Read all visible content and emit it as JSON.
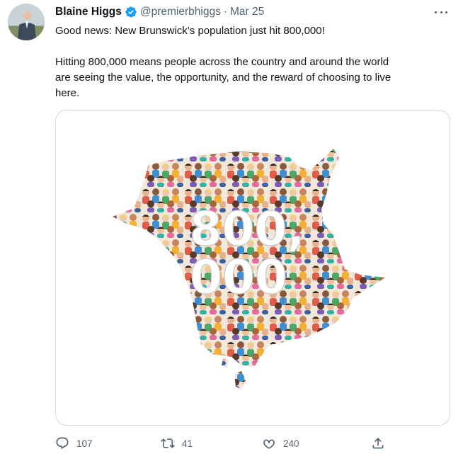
{
  "tweet": {
    "author_name": "Blaine Higgs",
    "handle": "@premierbhiggs",
    "separator": "·",
    "date": "Mar 25",
    "verified": true,
    "text_line1": "Good news: New Brunswick’s population just hit 800,000!",
    "text_line2": "Hitting 800,000 means people across the country and around the world",
    "text_line3": "are seeing the value, the opportunity, and the reward of choosing to live",
    "text_line4": "here."
  },
  "media": {
    "overlay_line1": "800,",
    "overlay_line2": "000"
  },
  "actions": {
    "reply_count": "107",
    "retweet_count": "41",
    "like_count": "240"
  },
  "colors": {
    "verified_blue": "#1d9bf0",
    "muted_text": "#536471",
    "border": "#cfd9de"
  },
  "icons": [
    "verified-badge-icon",
    "more-options-icon",
    "reply-icon",
    "retweet-icon",
    "like-icon",
    "share-icon"
  ]
}
